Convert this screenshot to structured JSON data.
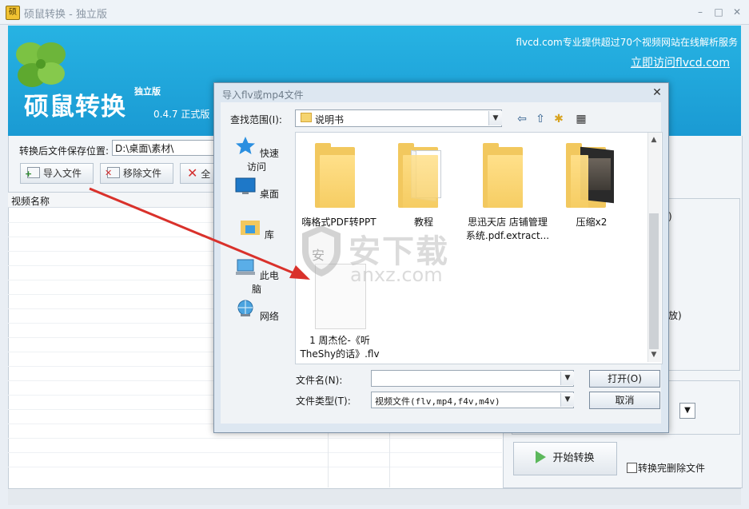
{
  "window": {
    "app_icon_text": "硕",
    "title": "硕鼠转换 - 独立版",
    "min_glyph": "–",
    "max_glyph": "□",
    "close_glyph": "✕"
  },
  "banner": {
    "app_name": "硕鼠转换",
    "edition": "独立版",
    "version": "0.4.7 正式版",
    "slogan": "flvcd.com专业提供超过70个视频网站在线解析服务",
    "link": "立即访问flvcd.com"
  },
  "toolbar": {
    "save_label": "转换后文件保存位置:",
    "save_path": "D:\\桌面\\素材\\",
    "import_label": "导入文件",
    "remove_label": "移除文件",
    "third_label_fragment": "全"
  },
  "list": {
    "column_name": "视频名称"
  },
  "right_panel": {
    "fragment1": ")",
    "fragment2": "放)",
    "combo_arrow": "▼",
    "start_label": "开始转换",
    "delete_after_label": "转换完删除文件"
  },
  "dialog": {
    "title": "导入flv或mp4文件",
    "close_glyph": "✕",
    "lookin_label": "查找范围(I):",
    "lookin_value": "说明书",
    "dropdown_glyph": "▼",
    "nav": {
      "back": "⇦",
      "up": "⇧",
      "new_folder": "✱",
      "view": "▦"
    },
    "places": [
      {
        "label": "快速访问",
        "icon": "star-icon"
      },
      {
        "label": "桌面",
        "icon": "desktop-icon"
      },
      {
        "label": "库",
        "icon": "library-icon"
      },
      {
        "label": "此电脑",
        "icon": "computer-icon"
      },
      {
        "label": "网络",
        "icon": "network-icon"
      }
    ],
    "files": [
      {
        "name_line1": "嗨格式PDF转PPT",
        "name_line2": "",
        "type": "folder"
      },
      {
        "name_line1": "教程",
        "name_line2": "",
        "type": "folder-docs"
      },
      {
        "name_line1": "思迅天店 店铺管理",
        "name_line2": "系统.pdf.extract...",
        "type": "folder"
      },
      {
        "name_line1": "压缩x2",
        "name_line2": "",
        "type": "folder-media"
      },
      {
        "name_line1": "1 周杰伦-《听",
        "name_line2": "TheShy的话》.flv",
        "type": "file"
      }
    ],
    "scroll_up": "▲",
    "scroll_down": "▼",
    "filename_label": "文件名(N):",
    "filename_value": "",
    "filetype_label": "文件类型(T):",
    "filetype_value": "视频文件(flv,mp4,f4v,m4v)",
    "open_label": "打开(O)",
    "cancel_label": "取消"
  },
  "watermark": {
    "cn": "安下载",
    "en": "anxz.com",
    "shield_char": "安"
  },
  "colors": {
    "banner": "#1fa6dc",
    "arrow": "#d9312b",
    "folder": "#f2c85e"
  }
}
